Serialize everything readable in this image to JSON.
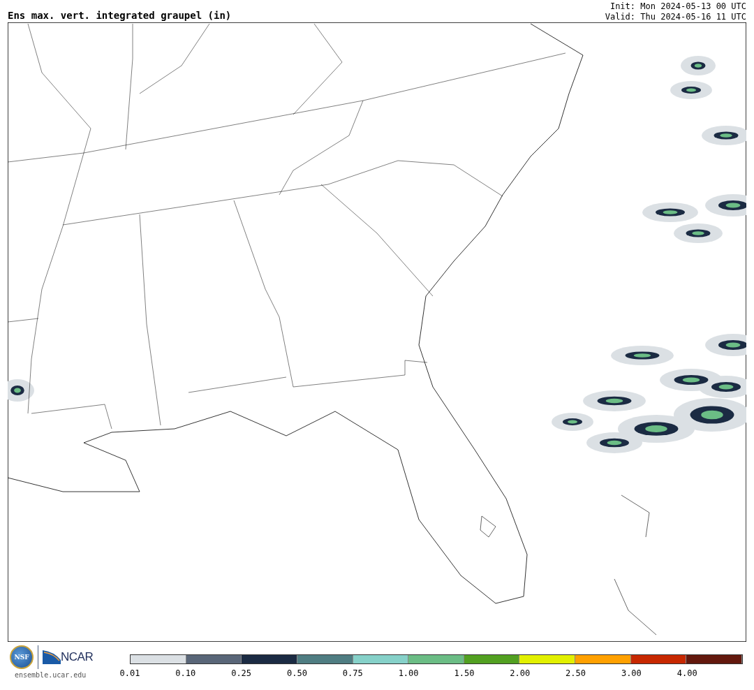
{
  "title": "Ens max. vert. integrated graupel (in)",
  "init": "Init: Mon 2024-05-13 00 UTC",
  "valid": "Valid: Thu 2024-05-16 11 UTC",
  "logos": {
    "nsf": "NSF",
    "ncar": "NCAR",
    "site": "ensemble.ucar.edu"
  },
  "colorbar": [
    {
      "label": "0.01",
      "color": "#dbe0e4"
    },
    {
      "label": "0.10",
      "color": "#596678"
    },
    {
      "label": "0.25",
      "color": "#1b2b43"
    },
    {
      "label": "0.50",
      "color": "#4f7d82"
    },
    {
      "label": "0.75",
      "color": "#86d1c9"
    },
    {
      "label": "1.00",
      "color": "#6bbd85"
    },
    {
      "label": "1.50",
      "color": "#52a021"
    },
    {
      "label": "2.00",
      "color": "#e2f000"
    },
    {
      "label": "2.50",
      "color": "#ffa000"
    },
    {
      "label": "3.00",
      "color": "#c72800"
    },
    {
      "label": "4.00",
      "color": "#63180d"
    }
  ]
}
